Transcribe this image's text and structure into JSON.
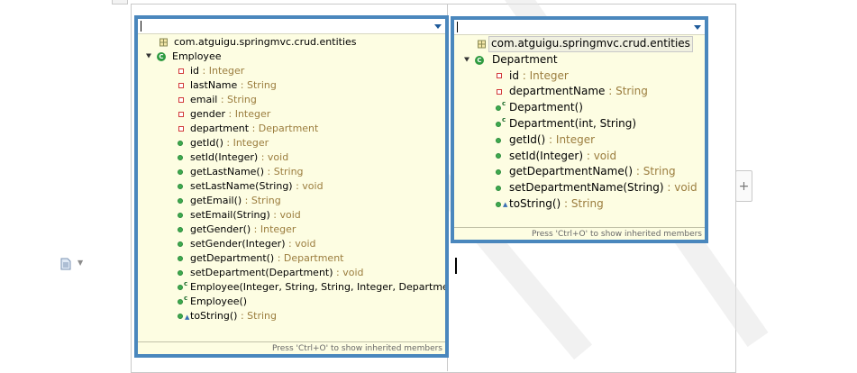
{
  "footer_hint": "Press 'Ctrl+O' to show inherited members",
  "add_button_label": "+",
  "colors": {
    "popup_border": "#4a87bd",
    "popup_bg": "#fdfde2",
    "type_text": "#9b7d3e",
    "method_icon": "#3eaa4f",
    "field_icon": "#d23a3a"
  },
  "left_outline": {
    "package": "com.atguigu.springmvc.crud.entities",
    "class_name": "Employee",
    "members": [
      {
        "kind": "field",
        "name": "id",
        "type": " : Integer"
      },
      {
        "kind": "field",
        "name": "lastName",
        "type": " : String"
      },
      {
        "kind": "field",
        "name": "email",
        "type": " : String"
      },
      {
        "kind": "field",
        "name": "gender",
        "type": " : Integer"
      },
      {
        "kind": "field",
        "name": "department",
        "type": " : Department"
      },
      {
        "kind": "method",
        "name": "getId()",
        "type": " : Integer"
      },
      {
        "kind": "method",
        "name": "setId(Integer)",
        "type": " : void"
      },
      {
        "kind": "method",
        "name": "getLastName()",
        "type": " : String"
      },
      {
        "kind": "method",
        "name": "setLastName(String)",
        "type": " : void"
      },
      {
        "kind": "method",
        "name": "getEmail()",
        "type": " : String"
      },
      {
        "kind": "method",
        "name": "setEmail(String)",
        "type": " : void"
      },
      {
        "kind": "method",
        "name": "getGender()",
        "type": " : Integer"
      },
      {
        "kind": "method",
        "name": "setGender(Integer)",
        "type": " : void"
      },
      {
        "kind": "method",
        "name": "getDepartment()",
        "type": " : Department"
      },
      {
        "kind": "method",
        "name": "setDepartment(Department)",
        "type": " : void"
      },
      {
        "kind": "ctor",
        "name": "Employee(Integer, String, String, Integer, Department)",
        "type": ""
      },
      {
        "kind": "ctor",
        "name": "Employee()",
        "type": ""
      },
      {
        "kind": "override",
        "name": "toString()",
        "type": " : String"
      }
    ]
  },
  "right_outline": {
    "package": "com.atguigu.springmvc.crud.entities",
    "class_name": "Department",
    "members": [
      {
        "kind": "field",
        "name": "id",
        "type": " : Integer"
      },
      {
        "kind": "field",
        "name": "departmentName",
        "type": " : String"
      },
      {
        "kind": "ctor",
        "name": "Department()",
        "type": ""
      },
      {
        "kind": "ctor",
        "name": "Department(int, String)",
        "type": ""
      },
      {
        "kind": "method",
        "name": "getId()",
        "type": " : Integer"
      },
      {
        "kind": "method",
        "name": "setId(Integer)",
        "type": " : void"
      },
      {
        "kind": "method",
        "name": "getDepartmentName()",
        "type": " : String"
      },
      {
        "kind": "method",
        "name": "setDepartmentName(String)",
        "type": " : void"
      },
      {
        "kind": "override",
        "name": "toString()",
        "type": " : String"
      }
    ]
  }
}
